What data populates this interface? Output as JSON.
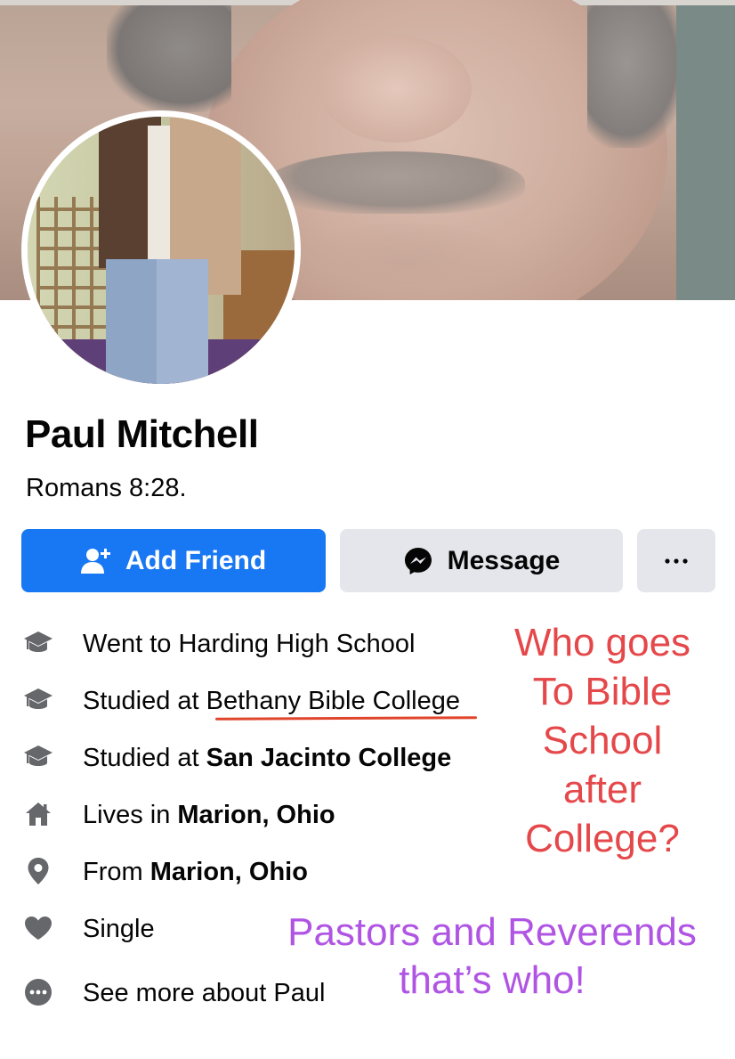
{
  "profile": {
    "name": "Paul Mitchell",
    "bio": "Romans 8:28."
  },
  "actions": {
    "add_friend_label": "Add Friend",
    "message_label": "Message",
    "more_label": "...",
    "accent_color": "#1877f2"
  },
  "intro": {
    "items": [
      {
        "icon": "graduation-cap-icon",
        "prefix": "Went to Harding High School",
        "bold": ""
      },
      {
        "icon": "graduation-cap-icon",
        "prefix": "Studied at Bethany Bible College",
        "bold": ""
      },
      {
        "icon": "graduation-cap-icon",
        "prefix": "Studied at ",
        "bold": "San Jacinto College"
      },
      {
        "icon": "home-icon",
        "prefix": "Lives in ",
        "bold": "Marion, Ohio"
      },
      {
        "icon": "location-pin-icon",
        "prefix": "From ",
        "bold": "Marion, Ohio"
      },
      {
        "icon": "heart-icon",
        "prefix": "Single",
        "bold": ""
      },
      {
        "icon": "more-circle-icon",
        "prefix": "See more about Paul",
        "bold": ""
      }
    ]
  },
  "annotations": {
    "red_lines": [
      "Who goes",
      "To Bible",
      "School",
      "after",
      "College?"
    ],
    "red_color": "#e5484a",
    "purple_lines": [
      "Pastors and Reverends",
      "that’s who!"
    ],
    "purple_color": "#b055e3",
    "underline_color": "#e0452c"
  }
}
